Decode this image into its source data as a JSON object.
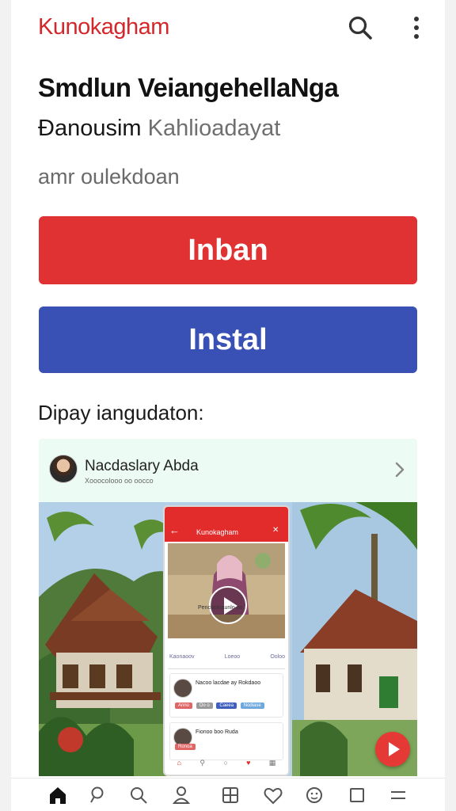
{
  "header": {
    "app_title": "Kunokagham",
    "search_icon": "search-icon",
    "more_icon": "more-vertical-icon"
  },
  "content": {
    "headline": "Smdlun VeiangehellaNga",
    "subline_dark": "Đanousim",
    "subline_light": "Kahlioadayat",
    "caption": "amr oulekdoan"
  },
  "buttons": {
    "primary_label": "Inban",
    "primary_color": "#e03232",
    "secondary_label": "Instal",
    "secondary_color": "#3950b5"
  },
  "section": {
    "label": "Dipay iangudaton:"
  },
  "account": {
    "name": "Nacdaslary Abda",
    "sub": "Xooocolooo oo oocco",
    "chevron_icon": "chevron-right-icon"
  },
  "hero": {
    "phone": {
      "title": "Kunokagham",
      "video_caption": "Pencoomaunlo oo",
      "tabs": [
        "Kaonaoov",
        "Loeoo",
        "Ooloo"
      ],
      "card1_title": "Nacoo lacdae ay Rokdaoo",
      "card1_pills": [
        "Anno",
        "Oo o",
        "Caeea",
        "Nodiase"
      ],
      "card2_title": "Fionoo boo Ruda",
      "card2_pill": "Ronoa"
    },
    "play_icon": "play-icon",
    "fab_icon": "play-circle-icon"
  },
  "bottom_nav": {
    "items": [
      "home-icon",
      "search-icon",
      "search-icon",
      "profile-icon",
      "grid-icon",
      "heart-icon",
      "emoji-icon",
      "square-icon",
      "menu-icon"
    ]
  },
  "colors": {
    "brand_red": "#d3272b",
    "card_tint": "#ecfbf4"
  }
}
